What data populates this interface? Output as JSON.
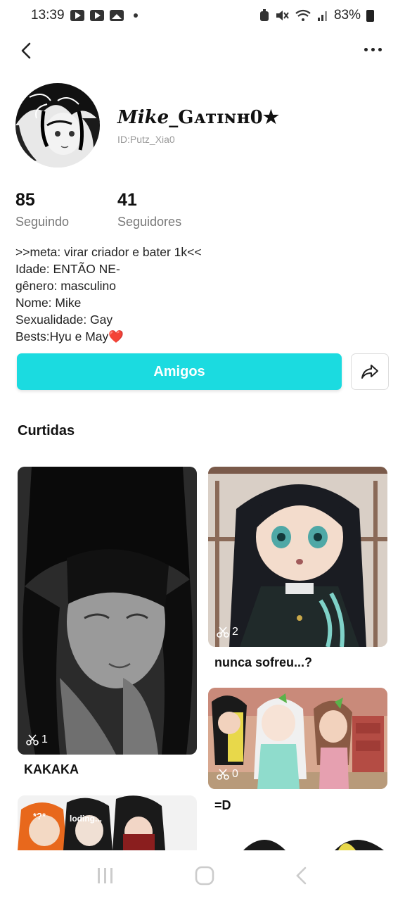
{
  "status_bar": {
    "time": "13:39",
    "battery": "83%"
  },
  "profile": {
    "name_italic": "Mike",
    "name_rest": "_Gᴀᴛɪɴʜ0★",
    "id": "ID:Putz_Xia0",
    "following_count": "85",
    "following_label": "Seguindo",
    "followers_count": "41",
    "followers_label": "Seguidores",
    "bio": [
      ">>meta: virar criador e bater 1k<<",
      "Idade: ENTÃO NE-",
      "gênero: masculino",
      "Nome: Mike",
      "Sexualidade: Gay",
      "Bests:Hyu e May❤️"
    ],
    "friends_button": "Amigos"
  },
  "liked_section": {
    "title": "Curtidas",
    "items": [
      {
        "title": "KAKAKA",
        "count": "1"
      },
      {
        "title": "nunca sofreu...?",
        "count": "2"
      },
      {
        "title": "=D",
        "count": "0"
      },
      {
        "overlay_text_1": "*?*",
        "overlay_text_2": "loding..."
      }
    ]
  },
  "colors": {
    "accent": "#1bdbe0"
  },
  "icons": {
    "back": "chevron-left-icon",
    "more": "more-dots-icon",
    "share": "share-arrow-icon",
    "scissors": "scissors-icon"
  }
}
